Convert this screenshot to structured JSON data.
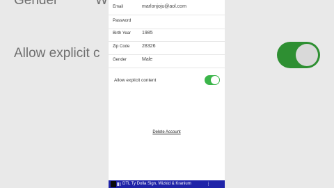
{
  "background": {
    "gender_text": "Gender",
    "partial_text": "W",
    "allow_text": "Allow explicit c",
    "toggle_color": "#2e8f32"
  },
  "profile": {
    "fields": [
      {
        "label": "Email",
        "value": "marlonjoju@aol.com"
      },
      {
        "label": "Password",
        "value": ""
      },
      {
        "label": "Birth Year",
        "value": "1985"
      },
      {
        "label": "Zip Code",
        "value": "28326"
      },
      {
        "label": "Gender",
        "value": "Male"
      }
    ],
    "explicit_label": "Allow explicit content",
    "explicit_enabled": true,
    "toggle_color": "#3bb54a",
    "delete_label": "Delete Account"
  },
  "now_playing": {
    "title": "DTL Ty Dolla Sign, Wizkid & Kranium",
    "menu_icon": "vertical-dots-icon",
    "bar_color": "#1f23a8"
  }
}
